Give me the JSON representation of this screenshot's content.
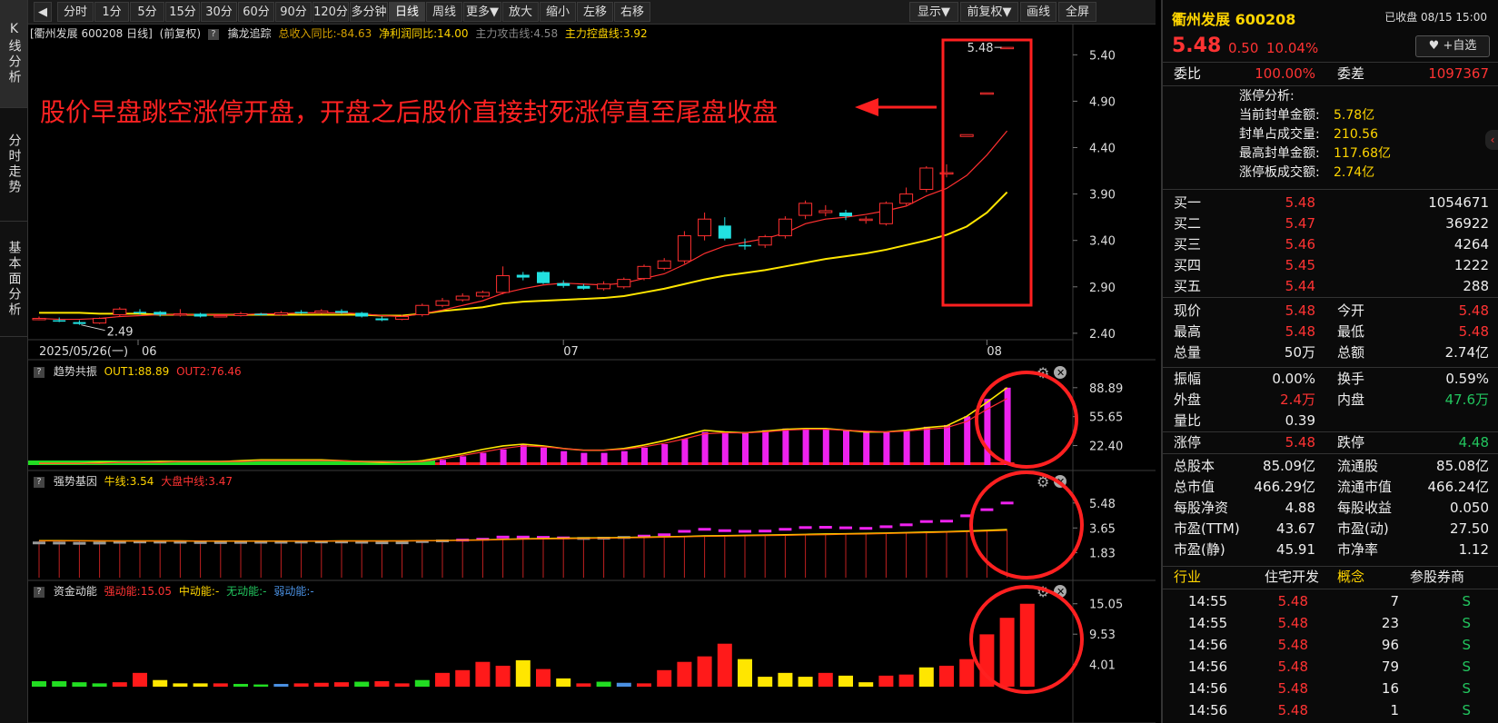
{
  "vtabs": [
    "K线分析",
    "分时走势",
    "基本面分析"
  ],
  "toolbar": {
    "left": [
      "分时",
      "1分",
      "5分",
      "15分",
      "30分",
      "60分",
      "90分",
      "120分",
      "多分钟",
      "日线",
      "周线",
      "更多▼",
      "放大",
      "缩小",
      "左移",
      "右移"
    ],
    "active": "日线",
    "right": [
      "显示▼",
      "前复权▼",
      "画线",
      "全屏"
    ]
  },
  "main_chart": {
    "header_name": "[衢州发展 600208 日线]",
    "header_adjust": "(前复权)",
    "indicator_name": "擒龙追踪",
    "ind1": "总收入同比:-84.63",
    "ind2": "净利润同比:14.00",
    "ind3": "主力攻击线:4.58",
    "ind4": "主力控盘线:3.92",
    "annotation": "股价早盘跳空涨停开盘，开盘之后股价直接封死涨停直至尾盘收盘",
    "high_label": "5.48",
    "low_label": "2.49",
    "date_left": "2025/05/26(一)",
    "month_labels": [
      "06",
      "07",
      "08"
    ]
  },
  "panel1": {
    "name": "趋势共振",
    "v1": "OUT1:88.89",
    "v2": "OUT2:76.46"
  },
  "panel2": {
    "name": "强势基因",
    "v1": "牛线:3.54",
    "v2": "大盘中线:3.47"
  },
  "panel3": {
    "name": "资金动能",
    "v1": "强动能:15.05",
    "v2": "中动能:-",
    "v3": "无动能:-",
    "v4": "弱动能:-"
  },
  "chart_data": [
    {
      "type": "candlestick",
      "title": "衢州发展 600208 日线",
      "y_ticks": [
        "5.40",
        "4.90",
        "4.40",
        "3.90",
        "3.40",
        "2.90",
        "2.40"
      ],
      "ylim": [
        2.35,
        5.55
      ],
      "candles": [
        [
          2.55,
          2.56,
          2.54,
          2.58
        ],
        [
          2.54,
          2.53,
          2.52,
          2.57
        ],
        [
          2.52,
          2.5,
          2.49,
          2.54
        ],
        [
          2.51,
          2.56,
          2.5,
          2.57
        ],
        [
          2.6,
          2.66,
          2.58,
          2.68
        ],
        [
          2.63,
          2.62,
          2.6,
          2.66
        ],
        [
          2.63,
          2.6,
          2.58,
          2.64
        ],
        [
          2.6,
          2.61,
          2.58,
          2.66
        ],
        [
          2.61,
          2.58,
          2.57,
          2.62
        ],
        [
          2.58,
          2.59,
          2.57,
          2.6
        ],
        [
          2.59,
          2.61,
          2.58,
          2.63
        ],
        [
          2.61,
          2.6,
          2.59,
          2.62
        ],
        [
          2.6,
          2.62,
          2.59,
          2.64
        ],
        [
          2.63,
          2.62,
          2.61,
          2.65
        ],
        [
          2.62,
          2.64,
          2.61,
          2.66
        ],
        [
          2.64,
          2.62,
          2.61,
          2.66
        ],
        [
          2.62,
          2.58,
          2.57,
          2.63
        ],
        [
          2.56,
          2.54,
          2.53,
          2.58
        ],
        [
          2.55,
          2.58,
          2.54,
          2.6
        ],
        [
          2.6,
          2.7,
          2.58,
          2.72
        ],
        [
          2.7,
          2.75,
          2.68,
          2.78
        ],
        [
          2.76,
          2.8,
          2.74,
          2.83
        ],
        [
          2.8,
          2.84,
          2.78,
          2.86
        ],
        [
          2.84,
          3.02,
          2.82,
          3.12
        ],
        [
          3.03,
          3.0,
          2.97,
          3.06
        ],
        [
          3.06,
          2.94,
          2.93,
          3.07
        ],
        [
          2.94,
          2.91,
          2.89,
          2.97
        ],
        [
          2.91,
          2.88,
          2.87,
          2.93
        ],
        [
          2.88,
          2.93,
          2.86,
          2.96
        ],
        [
          2.9,
          2.98,
          2.88,
          3.0
        ],
        [
          2.99,
          3.12,
          2.97,
          3.14
        ],
        [
          3.1,
          3.18,
          3.08,
          3.21
        ],
        [
          3.18,
          3.45,
          3.15,
          3.5
        ],
        [
          3.45,
          3.63,
          3.4,
          3.7
        ],
        [
          3.56,
          3.42,
          3.4,
          3.65
        ],
        [
          3.35,
          3.34,
          3.3,
          3.42
        ],
        [
          3.35,
          3.44,
          3.32,
          3.46
        ],
        [
          3.45,
          3.63,
          3.42,
          3.66
        ],
        [
          3.67,
          3.8,
          3.63,
          3.83
        ],
        [
          3.7,
          3.72,
          3.66,
          3.78
        ],
        [
          3.7,
          3.66,
          3.62,
          3.73
        ],
        [
          3.62,
          3.63,
          3.58,
          3.66
        ],
        [
          3.58,
          3.8,
          3.56,
          3.82
        ],
        [
          3.8,
          3.9,
          3.78,
          3.97
        ],
        [
          3.95,
          4.18,
          3.92,
          4.2
        ],
        [
          4.12,
          4.13,
          4.08,
          4.22
        ],
        [
          4.52,
          4.54,
          4.52,
          4.54
        ],
        [
          4.99,
          4.99,
          4.99,
          4.99
        ],
        [
          5.48,
          5.48,
          5.48,
          5.48
        ]
      ],
      "ma_yellow": [
        2.62,
        2.62,
        2.62,
        2.61,
        2.61,
        2.61,
        2.6,
        2.6,
        2.6,
        2.6,
        2.6,
        2.6,
        2.6,
        2.6,
        2.6,
        2.6,
        2.6,
        2.59,
        2.59,
        2.61,
        2.64,
        2.66,
        2.68,
        2.72,
        2.74,
        2.75,
        2.76,
        2.77,
        2.78,
        2.8,
        2.84,
        2.88,
        2.93,
        2.98,
        3.02,
        3.05,
        3.08,
        3.12,
        3.16,
        3.2,
        3.23,
        3.26,
        3.3,
        3.35,
        3.4,
        3.46,
        3.55,
        3.7,
        3.92
      ],
      "ma_red": [
        2.56,
        2.55,
        2.55,
        2.56,
        2.58,
        2.59,
        2.6,
        2.6,
        2.6,
        2.6,
        2.6,
        2.61,
        2.61,
        2.62,
        2.62,
        2.62,
        2.61,
        2.59,
        2.58,
        2.61,
        2.65,
        2.7,
        2.75,
        2.83,
        2.88,
        2.92,
        2.94,
        2.93,
        2.92,
        2.94,
        2.99,
        3.04,
        3.14,
        3.26,
        3.34,
        3.38,
        3.42,
        3.48,
        3.58,
        3.63,
        3.65,
        3.68,
        3.72,
        3.77,
        3.88,
        3.96,
        4.1,
        4.32,
        4.58
      ]
    },
    {
      "type": "bar",
      "title": "趋势共振",
      "y_ticks": [
        "88.89",
        "55.65",
        "22.40"
      ],
      "ylim": [
        0,
        96
      ],
      "values": [
        0,
        0,
        0,
        0,
        0,
        0,
        0,
        0,
        0,
        0,
        0,
        0,
        0,
        0,
        0,
        0,
        0,
        0,
        0,
        0,
        6,
        10,
        14,
        18,
        24,
        20,
        16,
        14,
        14,
        16,
        20,
        24,
        30,
        38,
        38,
        38,
        40,
        42,
        42,
        42,
        40,
        38,
        38,
        40,
        44,
        46,
        56,
        76,
        88.89
      ],
      "line_out1": [
        2,
        2,
        2,
        3,
        3,
        3,
        4,
        4,
        4,
        4,
        5,
        6,
        6,
        6,
        6,
        5,
        4,
        3,
        3,
        5,
        9,
        13,
        18,
        22,
        24,
        22,
        19,
        17,
        17,
        19,
        23,
        28,
        34,
        40,
        38,
        37,
        39,
        41,
        42,
        42,
        40,
        38,
        38,
        40,
        43,
        45,
        56,
        72,
        88.89
      ],
      "line_out2": [
        2,
        2,
        2,
        2,
        3,
        3,
        3,
        4,
        4,
        4,
        4,
        5,
        5,
        5,
        5,
        5,
        4,
        4,
        3,
        4,
        7,
        11,
        15,
        19,
        22,
        21,
        19,
        17,
        17,
        18,
        21,
        25,
        30,
        36,
        37,
        37,
        38,
        40,
        41,
        41,
        40,
        39,
        38,
        39,
        41,
        43,
        50,
        64,
        76.46
      ]
    },
    {
      "type": "bar",
      "title": "强势基因",
      "y_ticks": [
        "5.48",
        "3.65",
        "1.83"
      ],
      "ylim": [
        0,
        6.2
      ],
      "values": [
        2.55,
        2.54,
        2.52,
        2.54,
        2.6,
        2.62,
        2.61,
        2.6,
        2.58,
        2.58,
        2.59,
        2.6,
        2.6,
        2.61,
        2.62,
        2.62,
        2.6,
        2.56,
        2.56,
        2.65,
        2.7,
        2.76,
        2.82,
        2.98,
        2.98,
        2.96,
        2.92,
        2.88,
        2.9,
        2.95,
        3.05,
        3.15,
        3.4,
        3.55,
        3.45,
        3.4,
        3.42,
        3.55,
        3.68,
        3.7,
        3.66,
        3.62,
        3.74,
        3.88,
        4.12,
        4.15,
        4.54,
        4.99,
        5.48
      ],
      "line_bull": [
        2.72,
        2.72,
        2.71,
        2.7,
        2.7,
        2.7,
        2.7,
        2.7,
        2.69,
        2.69,
        2.69,
        2.69,
        2.69,
        2.69,
        2.69,
        2.7,
        2.7,
        2.7,
        2.7,
        2.71,
        2.73,
        2.75,
        2.78,
        2.82,
        2.85,
        2.88,
        2.9,
        2.92,
        2.93,
        2.95,
        2.98,
        3.0,
        3.03,
        3.07,
        3.09,
        3.11,
        3.13,
        3.15,
        3.18,
        3.21,
        3.23,
        3.25,
        3.28,
        3.31,
        3.35,
        3.38,
        3.43,
        3.48,
        3.54
      ],
      "line_mid": [
        2.7,
        2.7,
        2.7,
        2.7,
        2.69,
        2.69,
        2.69,
        2.69,
        2.69,
        2.68,
        2.68,
        2.68,
        2.68,
        2.69,
        2.69,
        2.69,
        2.69,
        2.69,
        2.7,
        2.71,
        2.72,
        2.74,
        2.76,
        2.79,
        2.82,
        2.84,
        2.86,
        2.88,
        2.9,
        2.92,
        2.94,
        2.97,
        3.0,
        3.03,
        3.05,
        3.07,
        3.09,
        3.11,
        3.14,
        3.16,
        3.19,
        3.21,
        3.24,
        3.27,
        3.3,
        3.34,
        3.38,
        3.42,
        3.47
      ]
    },
    {
      "type": "bar",
      "title": "资金动能",
      "y_ticks": [
        "15.05",
        "9.53",
        "4.01"
      ],
      "ylim": [
        0,
        15.5
      ],
      "values": [
        1.0,
        1.0,
        0.8,
        0.6,
        0.8,
        2.5,
        1.2,
        0.6,
        0.6,
        0.6,
        0.5,
        0.4,
        0.5,
        0.6,
        0.7,
        0.8,
        0.9,
        1.0,
        0.6,
        1.2,
        2.5,
        3.0,
        4.5,
        3.8,
        4.8,
        3.2,
        1.5,
        0.6,
        0.9,
        0.7,
        0.6,
        3.0,
        4.5,
        5.5,
        7.8,
        5.0,
        1.8,
        2.5,
        1.8,
        2.5,
        2.0,
        0.8,
        2.0,
        2.2,
        3.5,
        3.8,
        5.0,
        9.5,
        12.5,
        15.05
      ]
    }
  ],
  "right_panel": {
    "stock": "衢州发展 600208",
    "status": "已收盘 08/15 15:00",
    "price": "5.48",
    "change": "0.50",
    "change_pct": "10.04%",
    "fav_label": "+自选",
    "weibi_label": "委比",
    "weibi": "100.00%",
    "weicha_label": "委差",
    "weicha": "1097367",
    "zt_title": "涨停分析:",
    "zt_rows": [
      {
        "k": "当前封单金额:",
        "v": "5.78亿"
      },
      {
        "k": "封单占成交量:",
        "v": "210.56"
      },
      {
        "k": "最高封单金额:",
        "v": "117.68亿"
      },
      {
        "k": "涨停板成交额:",
        "v": "2.74亿"
      }
    ],
    "bids": [
      {
        "k": "买一",
        "p": "5.48",
        "v": "1054671"
      },
      {
        "k": "买二",
        "p": "5.47",
        "v": "36922"
      },
      {
        "k": "买三",
        "p": "5.46",
        "v": "4264"
      },
      {
        "k": "买四",
        "p": "5.45",
        "v": "1222"
      },
      {
        "k": "买五",
        "p": "5.44",
        "v": "288"
      }
    ],
    "quote": [
      {
        "k1": "现价",
        "v1": "5.48",
        "c1": "red",
        "k2": "今开",
        "v2": "5.48",
        "c2": "red"
      },
      {
        "k1": "最高",
        "v1": "5.48",
        "c1": "red",
        "k2": "最低",
        "v2": "5.48",
        "c2": "red"
      },
      {
        "k1": "总量",
        "v1": "50万",
        "c1": "white",
        "k2": "总额",
        "v2": "2.74亿",
        "c2": "white"
      }
    ],
    "quote2": [
      {
        "k1": "振幅",
        "v1": "0.00%",
        "c1": "white",
        "k2": "换手",
        "v2": "0.59%",
        "c2": "white"
      },
      {
        "k1": "外盘",
        "v1": "2.4万",
        "c1": "red",
        "k2": "内盘",
        "v2": "47.6万",
        "c2": "green"
      },
      {
        "k1": "量比",
        "v1": "0.39",
        "c1": "white",
        "k2": "",
        "v2": "",
        "c2": "white"
      }
    ],
    "quote3": [
      {
        "k1": "涨停",
        "v1": "5.48",
        "c1": "red",
        "k2": "跌停",
        "v2": "4.48",
        "c2": "green"
      }
    ],
    "fund": [
      {
        "k1": "总股本",
        "v1": "85.09亿",
        "k2": "流通股",
        "v2": "85.08亿"
      },
      {
        "k1": "总市值",
        "v1": "466.29亿",
        "k2": "流通市值",
        "v2": "466.24亿"
      },
      {
        "k1": "每股净资",
        "v1": "4.88",
        "k2": "每股收益",
        "v2": "0.050"
      },
      {
        "k1": "市盈(TTM)",
        "v1": "43.67",
        "k2": "市盈(动)",
        "v2": "27.50"
      },
      {
        "k1": "市盈(静)",
        "v1": "45.91",
        "k2": "市净率",
        "v2": "1.12"
      }
    ],
    "industry_label": "行业",
    "industry": "住宅开发",
    "concept_label": "概念",
    "concept": "参股券商",
    "trades": [
      {
        "t": "14:55",
        "p": "5.48",
        "v": "7",
        "s": "S"
      },
      {
        "t": "14:55",
        "p": "5.48",
        "v": "23",
        "s": "S"
      },
      {
        "t": "14:56",
        "p": "5.48",
        "v": "96",
        "s": "S"
      },
      {
        "t": "14:56",
        "p": "5.48",
        "v": "79",
        "s": "S"
      },
      {
        "t": "14:56",
        "p": "5.48",
        "v": "16",
        "s": "S"
      },
      {
        "t": "14:56",
        "p": "5.48",
        "v": "1",
        "s": "S"
      }
    ]
  }
}
